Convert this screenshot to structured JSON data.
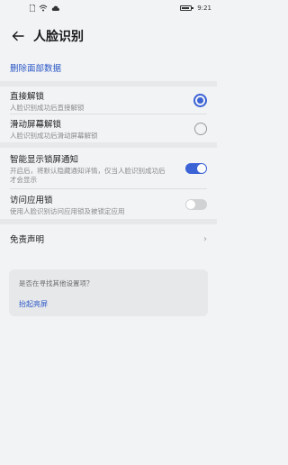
{
  "status": {
    "time": "9:21"
  },
  "header": {
    "title": "人脸识别"
  },
  "delete_data_label": "删除面部数据",
  "unlock": {
    "direct": {
      "title": "直接解锁",
      "subtitle": "人脸识别成功后直接解锁",
      "selected": true
    },
    "swipe": {
      "title": "滑动屏幕解锁",
      "subtitle": "人脸识别成功后滑动屏幕解锁",
      "selected": false
    }
  },
  "smart_notify": {
    "title": "智能显示锁屏通知",
    "subtitle": "开启后，将默认隐藏通知详情，仅当人脸识别成功后才会显示",
    "enabled": true
  },
  "app_lock": {
    "title": "访问应用锁",
    "subtitle": "使用人脸识别访问应用锁及被锁定应用",
    "enabled": false
  },
  "disclaimer": {
    "label": "免责声明"
  },
  "suggestion": {
    "question": "是否在寻找其他设置项？",
    "link": "抬起亮屏"
  }
}
